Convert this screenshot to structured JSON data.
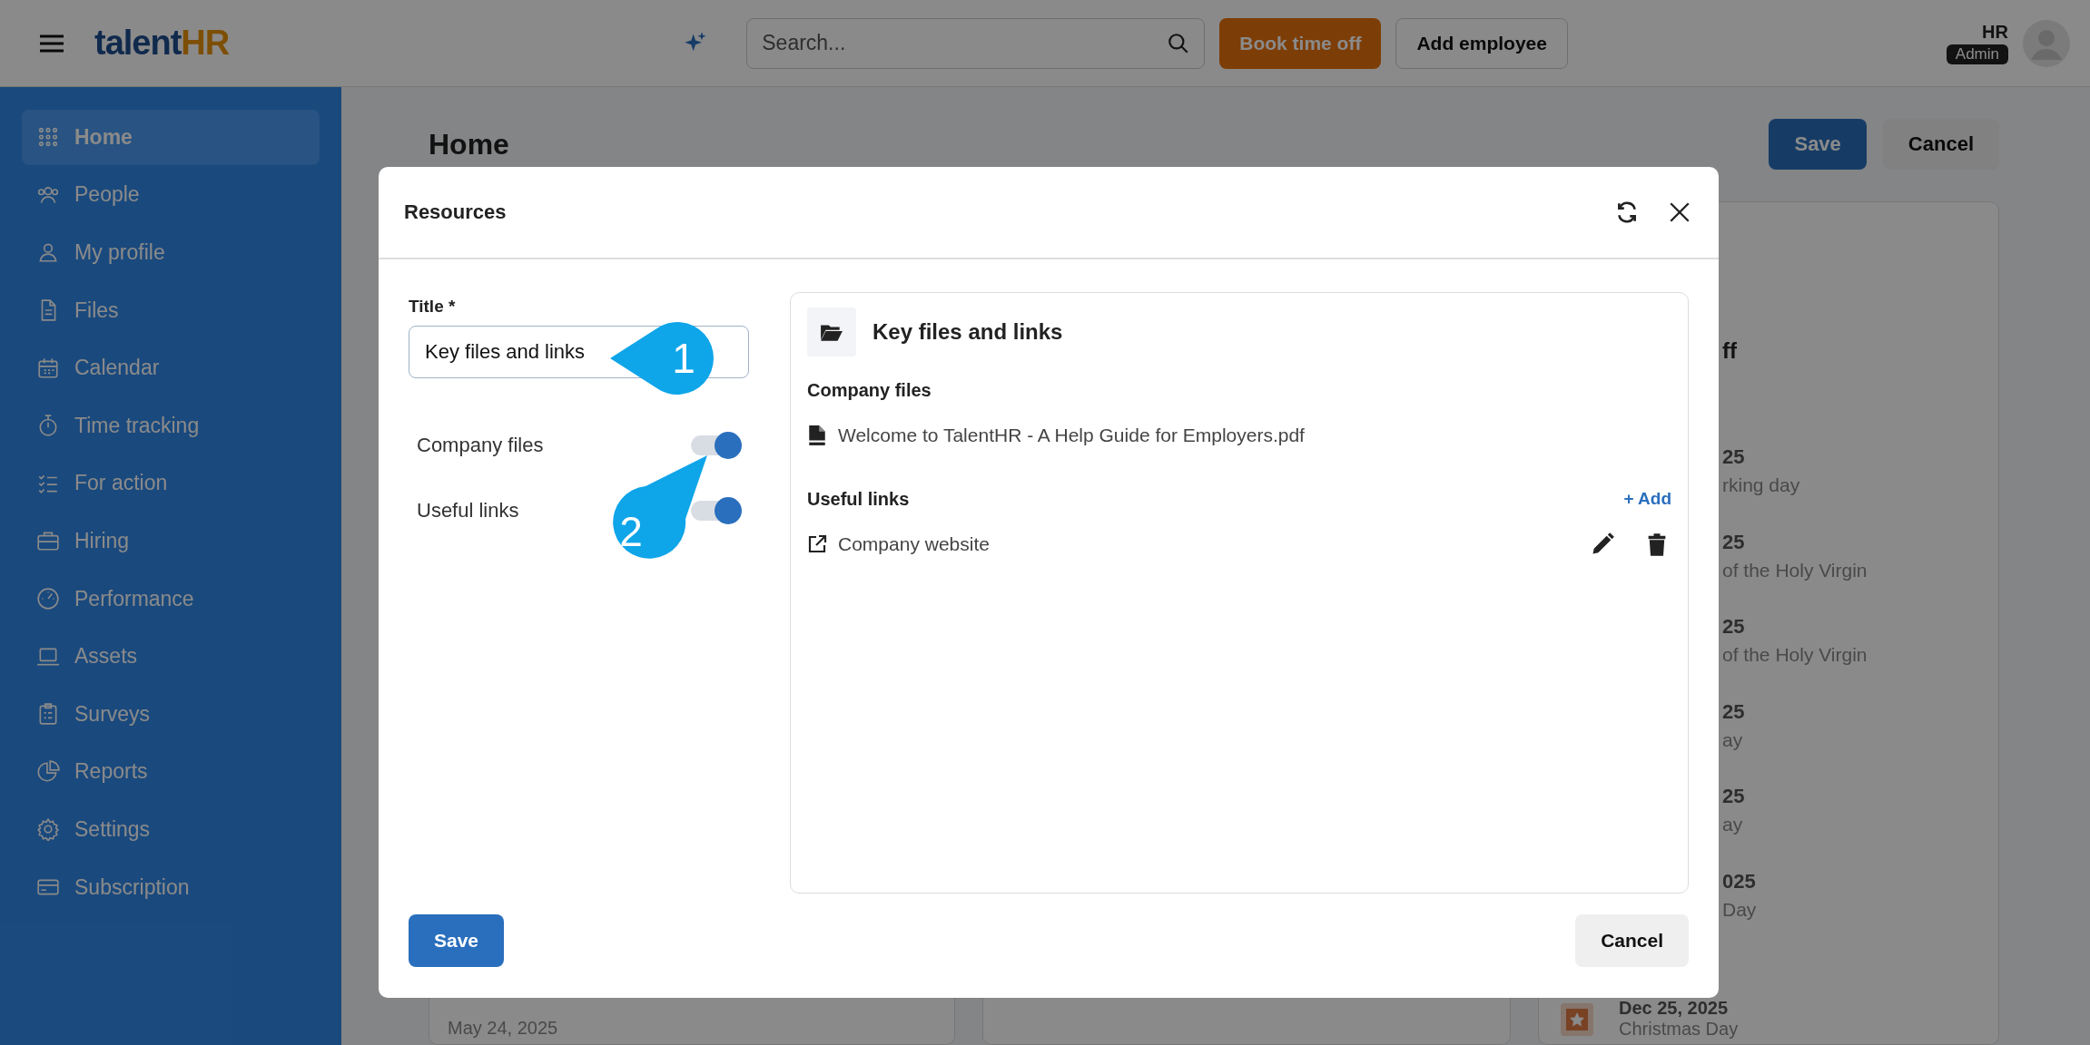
{
  "topbar": {
    "logo": {
      "main": "talent",
      "accent": "HR"
    },
    "search": {
      "placeholder": "Search..."
    },
    "buttons": [
      {
        "label": "Book time off",
        "kind": "primary"
      },
      {
        "label": "Add employee",
        "kind": "outline"
      }
    ],
    "user": {
      "name": "HR",
      "role": "Admin"
    }
  },
  "sidebar": {
    "items": [
      {
        "label": "Home",
        "selected": true
      },
      {
        "label": "People",
        "selected": false
      },
      {
        "label": "My profile",
        "selected": false
      },
      {
        "label": "Files",
        "selected": false
      },
      {
        "label": "Calendar",
        "selected": false
      },
      {
        "label": "Time tracking",
        "selected": false
      },
      {
        "label": "For action",
        "selected": false
      },
      {
        "label": "Hiring",
        "selected": false
      },
      {
        "label": "Performance",
        "selected": false
      },
      {
        "label": "Assets",
        "selected": false
      },
      {
        "label": "Surveys",
        "selected": false
      },
      {
        "label": "Reports",
        "selected": false
      },
      {
        "label": "Settings",
        "selected": false
      },
      {
        "label": "Subscription",
        "selected": false
      }
    ]
  },
  "page": {
    "title": "Home",
    "buttons": [
      {
        "label": "Save",
        "kind": "primary"
      },
      {
        "label": "Cancel",
        "kind": "secondary"
      }
    ],
    "left_card_date": "May 24, 2025",
    "right_card": {
      "heading": "ff",
      "rows": [
        {
          "date": "25",
          "name": "rking day"
        },
        {
          "date": "25",
          "name": "of the Holy Virgin"
        },
        {
          "date": "25",
          "name": "of the Holy Virgin"
        },
        {
          "date": "25",
          "name": "ay"
        },
        {
          "date": "25",
          "name": "ay"
        },
        {
          "date": "025",
          "name": "Day"
        }
      ],
      "last_row": {
        "date": "Dec 25, 2025",
        "name": "Christmas Day"
      }
    }
  },
  "dialog": {
    "title": "Resources",
    "title_field": {
      "label": "Title *",
      "value": "Key files and links"
    },
    "toggles": [
      {
        "label": "Company files",
        "checked": true
      },
      {
        "label": "Useful links",
        "checked": true
      }
    ],
    "preview": {
      "title": "Key files and links",
      "sections": [
        {
          "heading": "Company files",
          "items": [
            {
              "label": "Welcome to TalentHR - A Help Guide for Employers.pdf",
              "kind": "file"
            }
          ]
        },
        {
          "heading": "Useful links",
          "action": "+ Add",
          "items": [
            {
              "label": "Company website",
              "kind": "link"
            }
          ]
        }
      ]
    },
    "buttons": [
      {
        "label": "Save",
        "kind": "primary"
      },
      {
        "label": "Cancel",
        "kind": "secondary"
      }
    ]
  },
  "callouts": [
    {
      "number": "1"
    },
    {
      "number": "2"
    }
  ]
}
